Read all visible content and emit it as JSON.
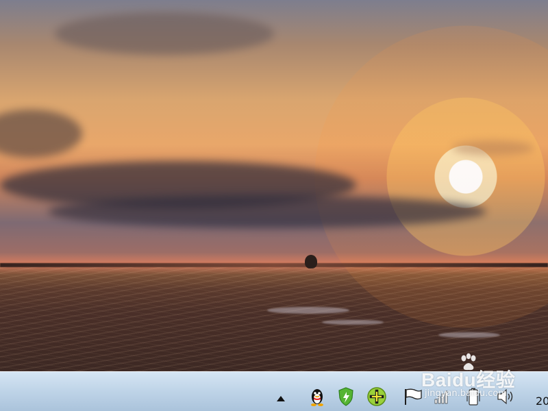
{
  "desktop": {
    "scene": "sunset-wallpaper"
  },
  "taskbar": {
    "tray_icons": [
      {
        "name": "show-hidden-icons",
        "icon": "triangle-up-icon"
      },
      {
        "name": "qq",
        "icon": "qq-penguin-icon"
      },
      {
        "name": "security",
        "icon": "green-shield-icon"
      },
      {
        "name": "plugin",
        "icon": "green-plus-icon"
      },
      {
        "name": "action-center",
        "icon": "flag-icon"
      },
      {
        "name": "network",
        "icon": "signal-bars-icon"
      },
      {
        "name": "power",
        "icon": "battery-icon"
      },
      {
        "name": "volume",
        "icon": "speaker-icon"
      }
    ],
    "clock_text": "20"
  },
  "watermark": {
    "brand": "Baidu经验",
    "domain": "jingyan.baidu.com"
  },
  "colors": {
    "taskbar_top": "#d5e5f3",
    "taskbar_bottom": "#aac3db",
    "sky_warm": "#e9a76a",
    "sun_glow": "#fff5c8",
    "ground_dark": "#3c2823"
  }
}
